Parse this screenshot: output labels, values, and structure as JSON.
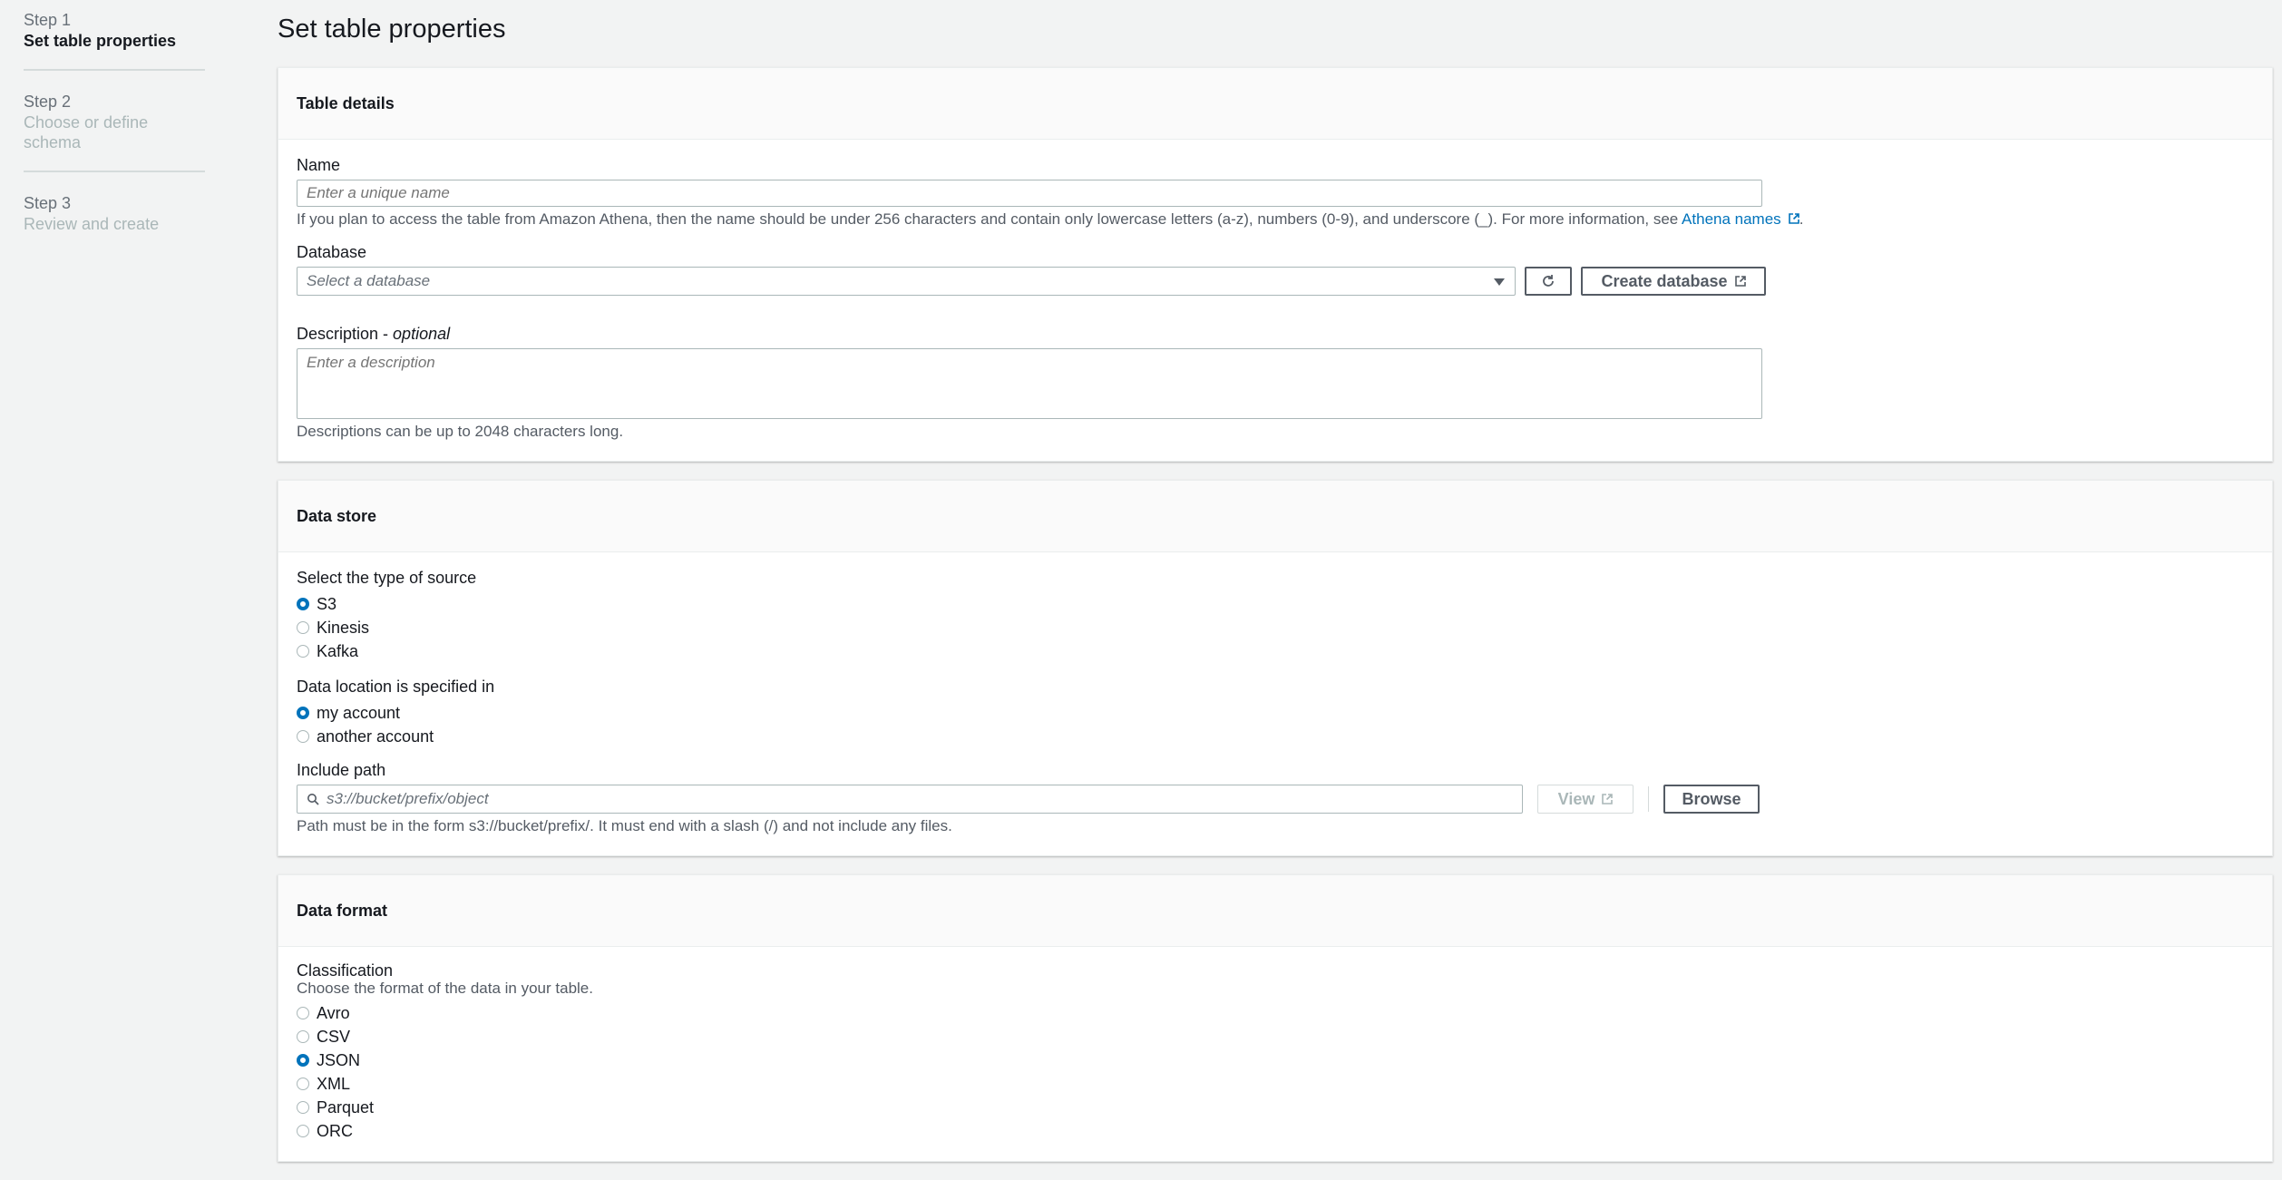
{
  "steps": [
    {
      "num": "Step 1",
      "title": "Set table properties"
    },
    {
      "num": "Step 2",
      "title": "Choose or define schema"
    },
    {
      "num": "Step 3",
      "title": "Review and create"
    }
  ],
  "page_title": "Set table properties",
  "table_details": {
    "header": "Table details",
    "name_label": "Name",
    "name_placeholder": "Enter a unique name",
    "name_hint": "If you plan to access the table from Amazon Athena, then the name should be under 256 characters and contain only lowercase letters (a-z), numbers (0-9), and underscore (_). For more information, see ",
    "name_hint_link": "Athena names",
    "database_label": "Database",
    "database_placeholder": "Select a database",
    "create_database_label": "Create database",
    "description_label": "Description",
    "description_optional": "optional",
    "description_placeholder": "Enter a description",
    "description_hint": "Descriptions can be up to 2048 characters long."
  },
  "data_store": {
    "header": "Data store",
    "source_label": "Select the type of source",
    "sources": [
      "S3",
      "Kinesis",
      "Kafka"
    ],
    "selected_source": "S3",
    "location_label": "Data location is specified in",
    "locations": [
      "my account",
      "another account"
    ],
    "selected_location": "my account",
    "path_label": "Include path",
    "path_placeholder": "s3://bucket/prefix/object",
    "view_label": "View",
    "browse_label": "Browse",
    "path_hint": "Path must be in the form s3://bucket/prefix/. It must end with a slash (/) and not include any files."
  },
  "data_format": {
    "header": "Data format",
    "classification_label": "Classification",
    "classification_hint": "Choose the format of the data in your table.",
    "formats": [
      "Avro",
      "CSV",
      "JSON",
      "XML",
      "Parquet",
      "ORC"
    ],
    "selected_format": "JSON"
  },
  "colors": {
    "accent": "#0073bb",
    "background": "#f2f3f3"
  }
}
